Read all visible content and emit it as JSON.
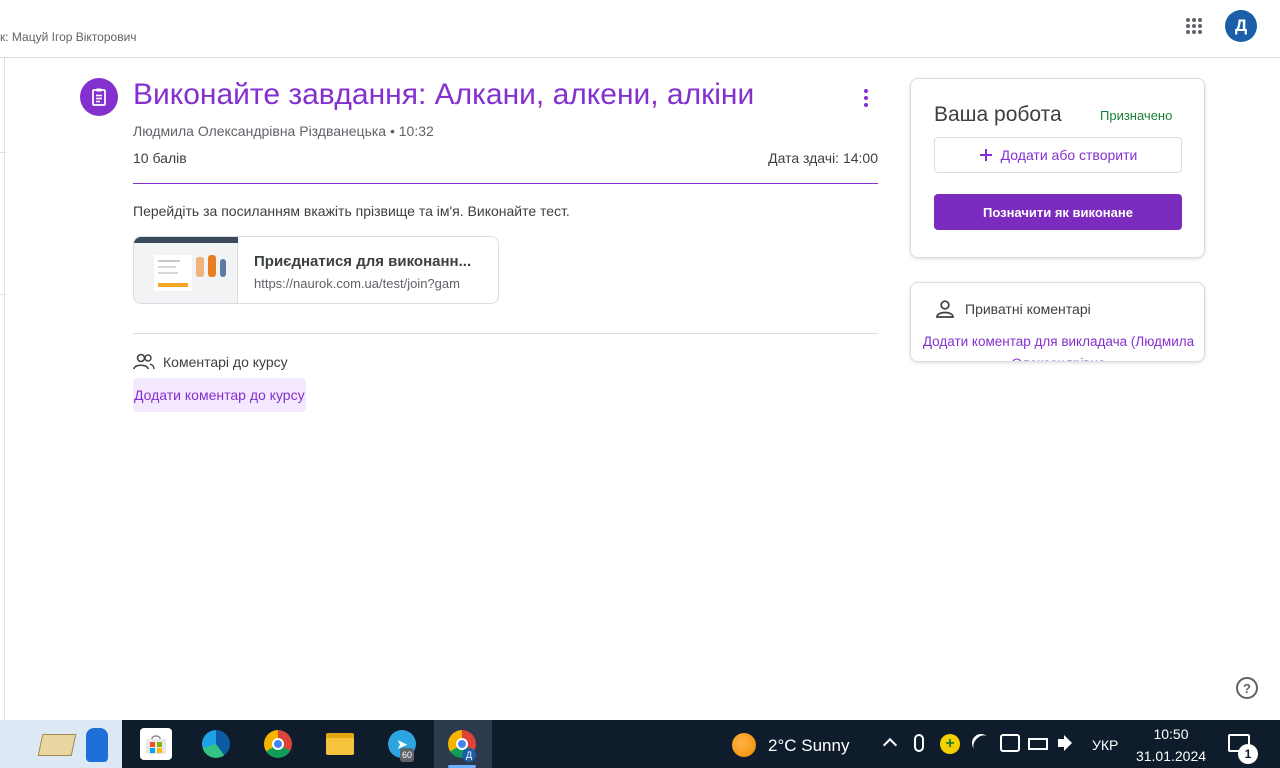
{
  "header": {
    "teacher_line": "к: Мацуй Ігор Вікторович",
    "avatar_letter": "Д"
  },
  "assignment": {
    "title": "Виконайте завдання: Алкани, алкени, алкіни",
    "author_time": "Людмила Олександрівна Різдванецька • 10:32",
    "points": "10 балів",
    "due": "Дата здачі: 14:00",
    "instructions": "Перейдіть за посиланням вкажіть прізвище та ім'я. Виконайте тест.",
    "link": {
      "title": "Приєднатися для виконанн...",
      "url": "https://naurok.com.ua/test/join?gam"
    },
    "class_comments": {
      "label": "Коментарі до курсу",
      "add": "Додати коментар до курсу"
    }
  },
  "your_work": {
    "title": "Ваша робота",
    "status": "Призначено",
    "add_label": "Додати або створити",
    "mark_done_label": "Позначити як виконане"
  },
  "private_comments": {
    "label": "Приватні коментарі",
    "add": "Додати коментар для викладача (Людмила Олександрівна"
  },
  "help": {
    "label": "?"
  },
  "taskbar": {
    "weather": "2°C  Sunny",
    "telegram_badge": "60",
    "chrome_profile_badge": "Д",
    "language": "УКР",
    "time": "10:50",
    "date": "31.01.2024",
    "notifications": "1"
  },
  "colors": {
    "accent": "#8430ce",
    "assigned_green": "#188038",
    "avatar_blue": "#1a5fa8",
    "taskbar": "#0f1c2c"
  }
}
